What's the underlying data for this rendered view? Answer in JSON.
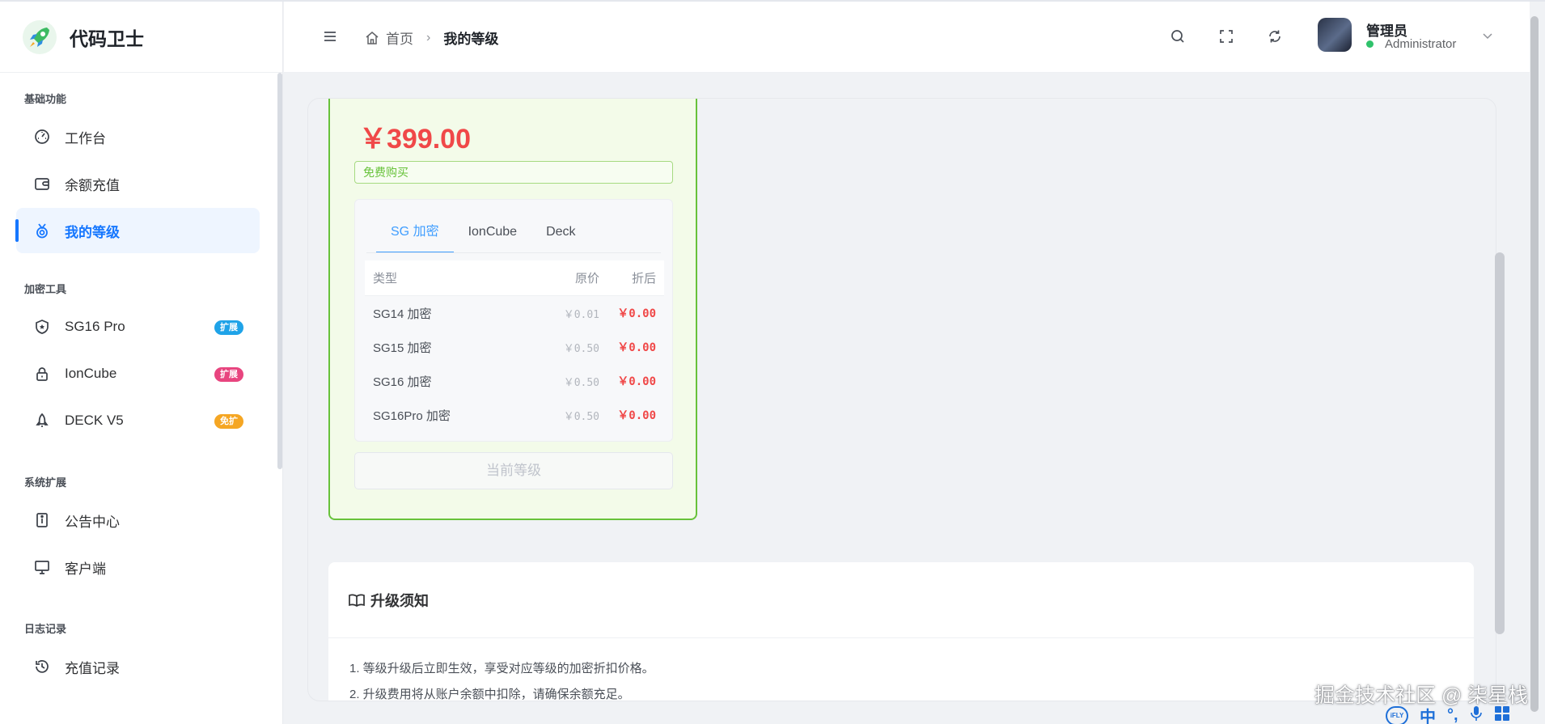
{
  "app": {
    "name": "代码卫士"
  },
  "sidebar": {
    "groups": [
      {
        "title": "基础功能",
        "items": [
          {
            "label": "工作台",
            "icon": "dashboard-icon"
          },
          {
            "label": "余额充值",
            "icon": "wallet-icon"
          },
          {
            "label": "我的等级",
            "icon": "medal-icon",
            "active": true
          }
        ]
      },
      {
        "title": "加密工具",
        "items": [
          {
            "label": "SG16 Pro",
            "icon": "shield-icon",
            "badge": "扩展",
            "badge_color": "#1fa3e8"
          },
          {
            "label": "IonCube",
            "icon": "lock-icon",
            "badge": "扩展",
            "badge_color": "#e8457f"
          },
          {
            "label": "DECK V5",
            "icon": "rocket-icon",
            "badge": "免扩",
            "badge_color": "#f5a623"
          }
        ]
      },
      {
        "title": "系统扩展",
        "items": [
          {
            "label": "公告中心",
            "icon": "notice-icon"
          },
          {
            "label": "客户端",
            "icon": "monitor-icon"
          }
        ]
      },
      {
        "title": "日志记录",
        "items": [
          {
            "label": "充值记录",
            "icon": "history-icon"
          }
        ]
      }
    ]
  },
  "header": {
    "breadcrumb": {
      "home": "首页",
      "current": "我的等级"
    },
    "user": {
      "name": "管理员",
      "role": "Administrator",
      "status_color": "#2fc26b"
    }
  },
  "plan": {
    "price": "￥399.00",
    "tag": "免费购买",
    "tabs": [
      "SG 加密",
      "IonCube",
      "Deck"
    ],
    "active_tab": 0,
    "table": {
      "headers": [
        "类型",
        "原价",
        "折后"
      ],
      "rows": [
        [
          "SG14 加密",
          "￥0.01",
          "￥0.00"
        ],
        [
          "SG15 加密",
          "￥0.50",
          "￥0.00"
        ],
        [
          "SG16 加密",
          "￥0.50",
          "￥0.00"
        ],
        [
          "SG16Pro 加密",
          "￥0.50",
          "￥0.00"
        ]
      ]
    },
    "button": "当前等级"
  },
  "notice": {
    "title": "升级须知",
    "items": [
      "1. 等级升级后立即生效，享受对应等级的加密折扣价格。",
      "2. 升级费用将从账户余额中扣除，请确保余额充足。"
    ]
  },
  "overlay": {
    "watermark": "掘金技术社区 @ 柒星栈",
    "ime": {
      "brand": "iFLY",
      "mode": "中"
    }
  },
  "colors": {
    "accent": "#1677ff",
    "price": "#f04848",
    "plan_border": "#67c23a"
  }
}
